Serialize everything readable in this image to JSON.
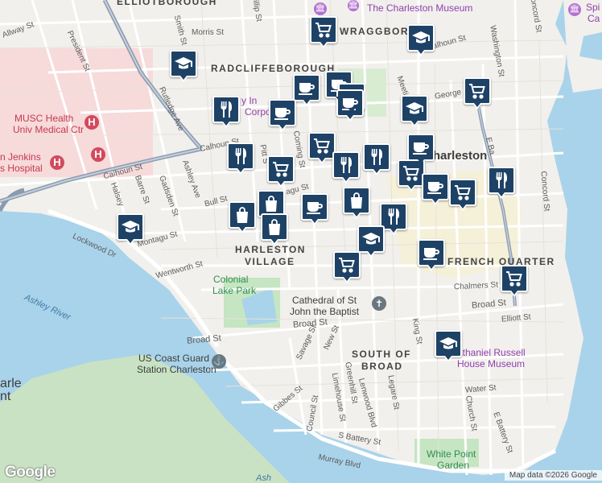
{
  "neighborhoods": {
    "elliotborough": "ELLIOTBOROUGH",
    "wraggborough": "WRAGGBORO",
    "radcliffeborough": "RADCLIFFEBOROUGH",
    "harleston": "HARLESTON",
    "village": "VILLAGE",
    "french_quarter": "FRENCH QUARTER",
    "south_of": "SOUTH OF",
    "broad": "BROAD",
    "charleston": "Charleston"
  },
  "pois": {
    "charleston_museum": "The Charleston Museum",
    "musc_line1": "MUSC Health",
    "musc_line2": "Univ Medical Ctr",
    "roper_line1": "n Jenkins",
    "roper_line2": "s Hospital",
    "hotel_line1": "y In",
    "hotel_line2": "Corporat",
    "colonial_line1": "Colonial",
    "colonial_line2": "Lake Park",
    "cathedral_line1": "Cathedral of St",
    "cathedral_line2": "John the Baptist",
    "coastguard_line1": "US Coast Guard",
    "coastguard_line2": "Station Charleston",
    "nathaniel_line1": "athaniel Russell",
    "nathaniel_line2": "House Museum",
    "whitepoint_line1": "White Point",
    "whitepoint_line2": "Garden",
    "spi_line1": "Spi",
    "spi_line2": "Ca",
    "arle_line1": "arle",
    "arle_line2": "nt"
  },
  "water": {
    "ashley_river": "Ashley River",
    "bottom": "Ash"
  },
  "streets": {
    "allway": "Allway St",
    "president": "President St",
    "smith": "Smith St",
    "morris": "Morris St",
    "phillip": "illip St",
    "rutledge": "Rutledge Ave",
    "calhoun_w": "Calhoun St",
    "calhoun_mid": "Calhoun St",
    "calhoun_e": "Calhoun St",
    "george": "George",
    "washington": "Washington St",
    "concord_n": "Concord St",
    "concord_s": "Concord St",
    "meeting": "Meeting St",
    "coming": "Coming St",
    "pitt": "Pitt S",
    "barre": "Barre St",
    "halsey": "Halsey",
    "gadsden": "Gadsden St",
    "ashley_ave": "Ashley Ave",
    "bull": "Bull St",
    "montagu_w": "Montagu St",
    "montagu_e": "agu St",
    "lockwood": "Lockwood Dr",
    "wentworth": "Wentworth St",
    "chalmers": "Chalmers St",
    "broad_e": "Broad St",
    "broad_mid": "Broad St",
    "broad_w": "Broad St",
    "elliott": "Elliott St",
    "savage": "Savage St",
    "new": "New St",
    "king": "King St",
    "gibbes": "Gibbes St",
    "council": "Council St",
    "limehouse": "Limehouse St",
    "greenhill": "Greenhill St",
    "lenwood": "Lenwood Blvd",
    "legare": "Legare St",
    "water": "Water St",
    "church": "Church St",
    "e_battery": "E Battery St",
    "s_battery": "S Battery St",
    "murray": "Murray Blvd",
    "east_bay": "E Ba"
  },
  "markers": [
    {
      "type": "grocery",
      "icon": "cart-icon"
    },
    {
      "type": "school",
      "icon": "graduation-cap-icon"
    },
    {
      "type": "school",
      "icon": "graduation-cap-icon"
    },
    {
      "type": "cafe",
      "icon": "coffee-cup-icon"
    },
    {
      "type": "cafe",
      "icon": "coffee-cup-icon"
    },
    {
      "type": "cafe",
      "icon": "coffee-cup-icon"
    },
    {
      "type": "cafe",
      "icon": "coffee-cup-icon"
    },
    {
      "type": "school",
      "icon": "graduation-cap-icon"
    },
    {
      "type": "grocery",
      "icon": "cart-icon"
    },
    {
      "type": "cafe",
      "icon": "coffee-cup-icon"
    },
    {
      "type": "restaurant",
      "icon": "fork-knife-icon"
    },
    {
      "type": "restaurant",
      "icon": "fork-knife-icon"
    },
    {
      "type": "grocery",
      "icon": "cart-icon"
    },
    {
      "type": "restaurant",
      "icon": "fork-knife-icon"
    },
    {
      "type": "restaurant",
      "icon": "fork-knife-icon"
    },
    {
      "type": "cafe",
      "icon": "coffee-cup-icon"
    },
    {
      "type": "grocery",
      "icon": "cart-icon"
    },
    {
      "type": "grocery",
      "icon": "cart-icon"
    },
    {
      "type": "cafe",
      "icon": "coffee-cup-icon"
    },
    {
      "type": "grocery",
      "icon": "cart-icon"
    },
    {
      "type": "restaurant",
      "icon": "fork-knife-icon"
    },
    {
      "type": "shopping",
      "icon": "shopping-bag-icon"
    },
    {
      "type": "cafe",
      "icon": "coffee-cup-icon"
    },
    {
      "type": "shopping",
      "icon": "shopping-bag-icon"
    },
    {
      "type": "shopping",
      "icon": "shopping-bag-icon"
    },
    {
      "type": "restaurant",
      "icon": "fork-knife-icon"
    },
    {
      "type": "shopping",
      "icon": "shopping-bag-icon"
    },
    {
      "type": "school",
      "icon": "graduation-cap-icon"
    },
    {
      "type": "school",
      "icon": "graduation-cap-icon"
    },
    {
      "type": "grocery",
      "icon": "cart-icon"
    },
    {
      "type": "cafe",
      "icon": "coffee-cup-icon"
    },
    {
      "type": "grocery",
      "icon": "cart-icon"
    },
    {
      "type": "school",
      "icon": "graduation-cap-icon"
    }
  ],
  "branding": {
    "logo": "Google",
    "attribution": "Map data ©2026 Google"
  },
  "colors": {
    "water": "#a9d3ea",
    "land": "#f2f0ec",
    "hospital": "#f7dada",
    "park": "#c6e5c3",
    "marker": "#1e4266",
    "highway": "#8a9bb0"
  }
}
